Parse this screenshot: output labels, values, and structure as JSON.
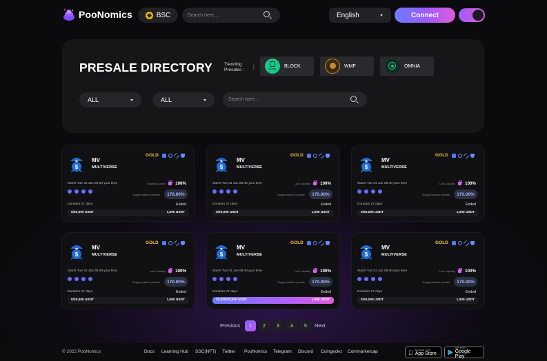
{
  "header": {
    "brand": "PooNomics",
    "chain": "BSC",
    "search_placeholder": "Search here...",
    "language": "English",
    "connect_label": "Connect"
  },
  "presale": {
    "title": "PRESALE DIRECTORY",
    "trending_label": "Trending Presales :",
    "trending_sep": "|",
    "trending": [
      {
        "name": "BLOCK",
        "icon_text": "BLOCK",
        "color": "#16c98d"
      },
      {
        "name": "WMF",
        "color": "#c58b2c"
      },
      {
        "name": "OMNIA",
        "color": "#1fbf7a"
      }
    ],
    "filters": [
      "ALL",
      "ALL"
    ],
    "search_placeholder": "Search here..."
  },
  "cards": [
    {
      "symbol": "MV",
      "name": "MULTIVERSE",
      "tier": "GOLD",
      "starts": "Starts Tue 31 Jan 08:40 your time",
      "lock_label": "Liquidity Locked",
      "lock_value": "100%",
      "supply_label": "Supply used for presale",
      "supply_value": "170.00%",
      "duration": "Duration 27 days",
      "status": "Ended",
      "raised": "0/20,000 USDT",
      "goal": "1,000 USDT",
      "progress_pct": 0
    },
    {
      "symbol": "MV",
      "name": "MULTIVERSE",
      "tier": "GOLD",
      "starts": "Starts Tue 31 Jan 08:40 your time",
      "lock_label": "Lock Liquidity",
      "lock_value": "100%",
      "supply_label": "Supply used for presale",
      "supply_value": "170.00%",
      "duration": "Duration 27 days",
      "status": "Ended",
      "raised": "0/20,000 USDT",
      "goal": "1,000 USDT",
      "progress_pct": 0
    },
    {
      "symbol": "MV",
      "name": "MULTIVERSE",
      "tier": "GOLD",
      "starts": "Starts Tue 31 Jan 08:40 your time",
      "lock_label": "Lock Liquidity",
      "lock_value": "100%",
      "supply_label": "Supply used for presale",
      "supply_value": "170.00%",
      "duration": "Duration 27 days",
      "status": "Ended",
      "raised": "0/20,000 USDT",
      "goal": "1,000 USDT",
      "progress_pct": 0
    },
    {
      "symbol": "MV",
      "name": "MULTIVERSE",
      "tier": "GOLD",
      "starts": "Starts Tue 31 Jan 08:40 your time",
      "lock_label": "Lock Liquidity",
      "lock_value": "100%",
      "supply_label": "Supply used for presale",
      "supply_value": "170.00%",
      "duration": "Duration 27 days",
      "status": "Ended",
      "raised": "0/20,000 USDT",
      "goal": "1,000 USDT",
      "progress_pct": 0
    },
    {
      "symbol": "MV",
      "name": "MULTIVERSE",
      "tier": "GOLD",
      "starts": "Starts Tue 31 Jan 08:40 your time",
      "lock_label": "Lock Liquidity",
      "lock_value": "100%",
      "supply_label": "Supply used for presale",
      "supply_value": "170.00%",
      "duration": "Duration 27 days",
      "status": "Ended",
      "raised": "20,000/20,000 USDT",
      "goal": "1,000 USDT",
      "progress_pct": 100
    },
    {
      "symbol": "MV",
      "name": "MULTIVERSE",
      "tier": "GOLD",
      "starts": "Starts Tue 31 Jan 08:40 your time",
      "lock_label": "Lock Liquidity",
      "lock_value": "100%",
      "supply_label": "Supply used for presale",
      "supply_value": "170.00%",
      "duration": "Duration 27 days",
      "status": "Ended",
      "raised": "0/20,000 USDT",
      "goal": "1,000 USDT",
      "progress_pct": 0
    }
  ],
  "pagination": {
    "prev": "Previous",
    "pages": [
      "1",
      "2",
      "3",
      "4",
      "5"
    ],
    "current": "1",
    "next": "Next"
  },
  "footer": {
    "copyright": "© 2022 PooNomics",
    "links": [
      "Docs",
      "Learning Hub",
      "SSC(NFT)",
      "Twitter",
      "PooNomics",
      "Telegram",
      "Discord",
      "Coingecko",
      "Coinmarketcap"
    ],
    "app_store": {
      "caption": "Download on the",
      "label": "App Store"
    },
    "google_play": {
      "caption": "GET IT ON",
      "label": "Google Play"
    }
  },
  "colors": {
    "accent": "#9b5cff",
    "gold": "#f5c244",
    "background": "#0b0b0d"
  }
}
